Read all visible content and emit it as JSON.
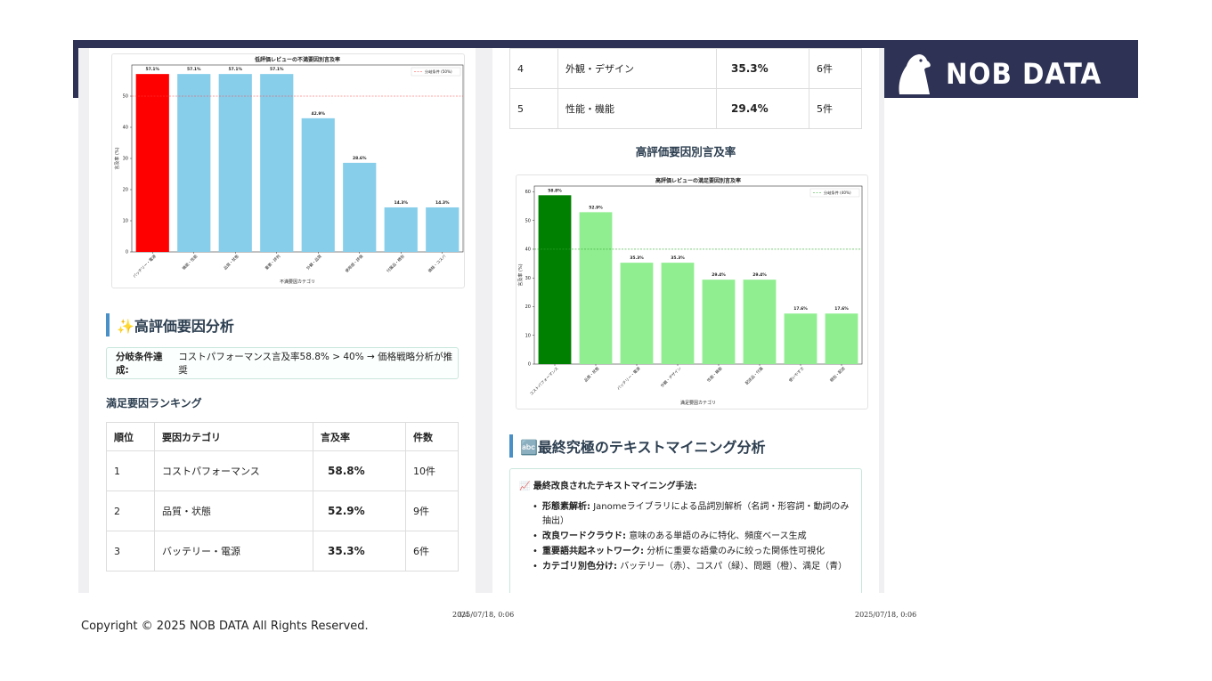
{
  "brand": {
    "name": "NOB DATA"
  },
  "left": {
    "chart": {
      "title": "低評価レビューの不満要因別言及率",
      "xlabel": "不満要因カテゴリ",
      "ylabel": "言及率 (%)",
      "legend": "分岐条件 (50%)",
      "threshold": 50,
      "ylim": [
        0,
        60
      ],
      "yticks": [
        "0",
        "10",
        "20",
        "30",
        "40",
        "50"
      ],
      "categories": [
        "バッテリー・電源",
        "機能・性能",
        "品質・状態",
        "重要・評判",
        "外観・品質",
        "使用感・評価",
        "付属品・梱包",
        "価格・コスパ"
      ],
      "values": [
        57.1,
        57.1,
        57.1,
        57.1,
        42.9,
        28.6,
        14.3,
        14.3
      ],
      "labels": [
        "57.1%",
        "57.1%",
        "57.1%",
        "57.1%",
        "42.9%",
        "28.6%",
        "14.3%",
        "14.3%"
      ],
      "highlight_color": "#ff0000",
      "bar_color": "#87ceeb"
    },
    "section_title": "✨高評価要因分析",
    "notice_label": "分岐条件達成:",
    "notice_text": "コストパフォーマンス言及率58.8% > 40% → 価格戦略分析が推奨",
    "ranking_heading": "満足要因ランキング",
    "table": {
      "headers": [
        "順位",
        "要因カテゴリ",
        "言及率",
        "件数"
      ],
      "rows": [
        {
          "rank": "1",
          "category": "コストパフォーマンス",
          "rate": "58.8%",
          "count": "10件"
        },
        {
          "rank": "2",
          "category": "品質・状態",
          "rate": "52.9%",
          "count": "9件"
        },
        {
          "rank": "3",
          "category": "バッテリー・電源",
          "rate": "35.3%",
          "count": "6件"
        }
      ]
    }
  },
  "right": {
    "table_rows": [
      {
        "rank": "4",
        "category": "外観・デザイン",
        "rate": "35.3%",
        "count": "6件"
      },
      {
        "rank": "5",
        "category": "性能・機能",
        "rate": "29.4%",
        "count": "5件"
      }
    ],
    "chart_heading": "高評価要因別言及率",
    "chart": {
      "title": "高評価レビューの満足要因別言及率",
      "xlabel": "満足要因カテゴリ",
      "ylabel": "言及率 (%)",
      "legend": "分岐条件 (40%)",
      "threshold": 40,
      "ylim": [
        0,
        62
      ],
      "yticks": [
        "0",
        "10",
        "20",
        "30",
        "40",
        "50",
        "60"
      ],
      "categories": [
        "コストパフォーマンス",
        "品質・状態",
        "バッテリー・電源",
        "外観・デザイン",
        "性能・機能",
        "配送品・付属",
        "使いやすさ",
        "梱包・配送"
      ],
      "values": [
        58.8,
        52.9,
        35.3,
        35.3,
        29.4,
        29.4,
        17.6,
        17.6
      ],
      "labels": [
        "58.8%",
        "52.9%",
        "35.3%",
        "35.3%",
        "29.4%",
        "29.4%",
        "17.6%",
        "17.6%"
      ],
      "highlight_color": "#008000",
      "bar_color": "#90ee90"
    },
    "section_title": "🔤最終究極のテキストマイニング分析",
    "methods_title": "📈 最終改良されたテキストマイニング手法:",
    "methods": [
      {
        "label": "形態素解析:",
        "text": "Janomeライブラリによる品詞別解析（名詞・形容詞・動詞のみ抽出）"
      },
      {
        "label": "改良ワードクラウド:",
        "text": "意味のある単語のみに特化、頻度ベース生成"
      },
      {
        "label": "重要語共起ネットワーク:",
        "text": "分析に重要な語彙のみに絞った関係性可視化"
      },
      {
        "label": "カテゴリ別色分け:",
        "text": "バッテリー（赤）、コスパ（緑）、問題（橙）、満足（青）"
      }
    ]
  },
  "chart_data": [
    {
      "type": "bar",
      "title": "低評価レビューの不満要因別言及率",
      "xlabel": "不満要因カテゴリ",
      "ylabel": "言及率 (%)",
      "categories": [
        "バッテリー・電源",
        "機能・性能",
        "品質・状態",
        "重要・評判",
        "外観・品質",
        "使用感・評価",
        "付属品・梱包",
        "価格・コスパ"
      ],
      "values": [
        57.1,
        57.1,
        57.1,
        57.1,
        42.9,
        28.6,
        14.3,
        14.3
      ],
      "ylim": [
        0,
        60
      ],
      "reference_line": {
        "value": 50,
        "label": "分岐条件 (50%)"
      }
    },
    {
      "type": "bar",
      "title": "高評価レビューの満足要因別言及率",
      "xlabel": "満足要因カテゴリ",
      "ylabel": "言及率 (%)",
      "categories": [
        "コストパフォーマンス",
        "品質・状態",
        "バッテリー・電源",
        "外観・デザイン",
        "性能・機能",
        "配送品・付属",
        "使いやすさ",
        "梱包・配送"
      ],
      "values": [
        58.8,
        52.9,
        35.3,
        35.3,
        29.4,
        29.4,
        17.6,
        17.6
      ],
      "ylim": [
        0,
        62
      ],
      "reference_line": {
        "value": 40,
        "label": "分岐条件 (40%)"
      }
    }
  ],
  "footer": {
    "copyright": "Copyright © 2025 NOB DATA All Rights Reserved.",
    "stamp_mid": "2025/07/18, 0:06",
    "stamp_mid_overlap": "3/4",
    "stamp_right": "2025/07/18, 0:06"
  }
}
